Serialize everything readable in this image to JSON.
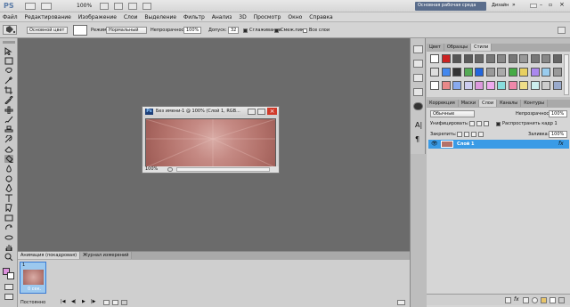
{
  "app": {
    "logo": "PS",
    "zoom": "100%",
    "workspace_button": "Основная рабочая среда",
    "design_label": "Дизайн",
    "colors": {
      "workspace_button": "#5a6d8c",
      "selection": "#3a9be6",
      "close": "#d03a2a"
    }
  },
  "menu": {
    "items": [
      "Файл",
      "Редактирование",
      "Изображение",
      "Слои",
      "Выделение",
      "Фильтр",
      "Анализ",
      "3D",
      "Просмотр",
      "Окно",
      "Справка"
    ]
  },
  "options": {
    "source_select": "Основной цвет",
    "mode_label": "Режим:",
    "mode_value": "Нормальный",
    "opacity_label": "Непрозрачность:",
    "opacity_value": "100%",
    "tolerance_label": "Допуск:",
    "tolerance_value": "32",
    "antialias_label": "Сглаживание",
    "contiguous_label": "Смеж.пикс",
    "all_layers_label": "Все слои",
    "antialias_checked": true,
    "contiguous_checked": true,
    "all_layers_checked": false
  },
  "tools": {
    "icons": [
      "move-icon",
      "marquee-icon",
      "lasso-icon",
      "magic-wand-icon",
      "crop-icon",
      "eyedropper-icon",
      "healing-brush-icon",
      "brush-icon",
      "clone-stamp-icon",
      "history-brush-icon",
      "eraser-icon",
      "paint-bucket-icon",
      "blur-icon",
      "dodge-icon",
      "pen-icon",
      "type-icon",
      "path-selection-icon",
      "rectangle-icon",
      "3d-rotate-icon",
      "3d-orbit-icon",
      "hand-icon",
      "zoom-icon"
    ]
  },
  "document": {
    "ps_badge": "Ps",
    "title": "Без имени-1 @ 100% (Слой 1, RGB...",
    "zoom": "100%"
  },
  "swatches_panel": {
    "tabs": [
      "Цвет",
      "Образцы",
      "Стили"
    ],
    "active_tab": "Стили"
  },
  "layers_panel": {
    "tabs": [
      "Коррекция",
      "Маски",
      "Слои",
      "Каналы",
      "Контуры"
    ],
    "active_tab": "Слои",
    "blend_mode": "Обычные",
    "opacity_label": "Непрозрачность:",
    "opacity_value": "100%",
    "unify_label": "Унифицировать:",
    "propagate_label": "Распространить кадр 1",
    "lock_label": "Закрепить:",
    "fill_label": "Заливка:",
    "fill_value": "100%",
    "layers": [
      {
        "name": "Слой 1",
        "selected": true,
        "fx": "fx"
      }
    ]
  },
  "animation_panel": {
    "tabs": [
      "Анимация (покадровая)",
      "Журнал измерений"
    ],
    "active_tab": "Анимация (покадровая)",
    "frame_number": "1",
    "frame_duration": "0 сек.",
    "loop": "Постоянно"
  }
}
